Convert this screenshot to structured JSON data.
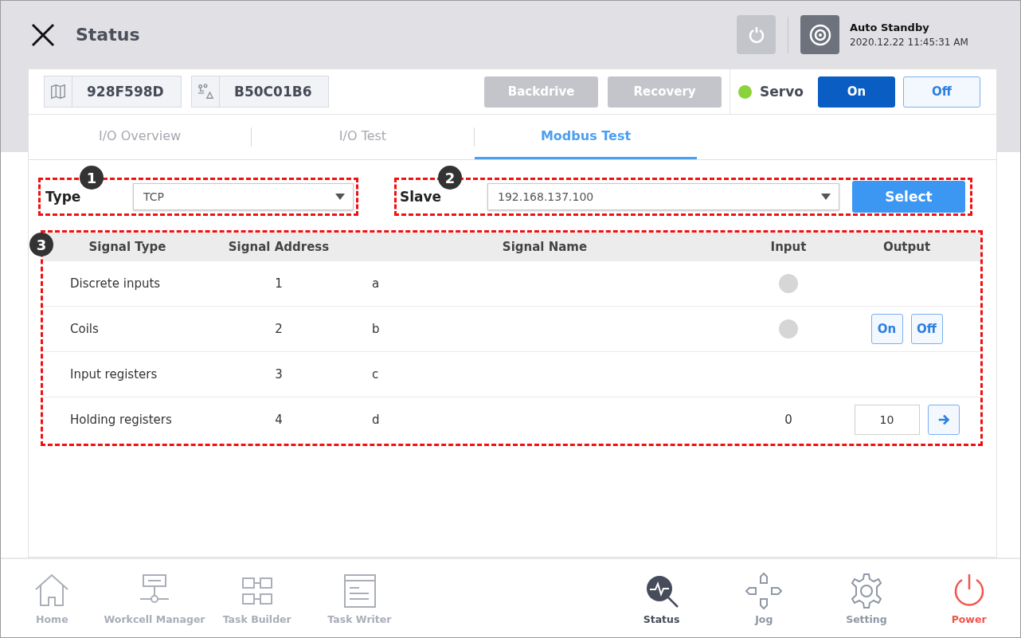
{
  "header": {
    "title": "Status",
    "mode": "Auto Standby",
    "datetime": "2020.12.22 11:45:31 AM"
  },
  "ids": [
    {
      "kind": "map",
      "text": "928F598D"
    },
    {
      "kind": "robot",
      "text": "B50C01B6"
    }
  ],
  "actions": [
    {
      "label": "Backdrive",
      "disabled": true
    },
    {
      "label": "Recovery",
      "disabled": true
    }
  ],
  "servo": {
    "label": "Servo",
    "on": true,
    "buttons": [
      {
        "label": "On",
        "selected": true
      },
      {
        "label": "Off",
        "selected": false
      }
    ]
  },
  "tabs": [
    {
      "label": "I/O Overview",
      "selected": false
    },
    {
      "label": "I/O Test",
      "selected": false
    },
    {
      "label": "Modbus Test",
      "selected": true
    }
  ],
  "type_field": {
    "callout": "1",
    "label": "Type",
    "value": "TCP"
  },
  "slave_field": {
    "callout": "2",
    "label": "Slave",
    "value": "192.168.137.100",
    "button": "Select"
  },
  "table": {
    "callout": "3",
    "columns": [
      "Signal Type",
      "Signal Address",
      "Signal Name",
      "Input",
      "Output"
    ],
    "rows": [
      {
        "signal_type": "Discrete inputs",
        "address": "1",
        "name": "a",
        "input": {
          "kind": "lamp",
          "on": false
        }
      },
      {
        "signal_type": "Coils",
        "address": "2",
        "name": "b",
        "input": {
          "kind": "lamp",
          "on": false
        },
        "output": {
          "kind": "toggle",
          "buttons": [
            "On",
            "Off"
          ]
        }
      },
      {
        "signal_type": "Input registers",
        "address": "3",
        "name": "c"
      },
      {
        "signal_type": "Holding registers",
        "address": "4",
        "name": "d",
        "input": {
          "kind": "value",
          "text": "0"
        },
        "output": {
          "kind": "entry",
          "value": "10"
        }
      }
    ]
  },
  "nav": [
    {
      "kind": "home",
      "label": "Home",
      "disabled": true,
      "selected": false
    },
    {
      "kind": "workcell",
      "label": "Workcell Manager",
      "disabled": true,
      "selected": false
    },
    {
      "kind": "builder",
      "label": "Task Builder",
      "disabled": true,
      "selected": false
    },
    {
      "kind": "writer",
      "label": "Task Writer",
      "disabled": true,
      "selected": false
    },
    {
      "kind": "status",
      "label": "Status",
      "disabled": false,
      "selected": true
    },
    {
      "kind": "jog",
      "label": "Jog",
      "disabled": false,
      "selected": false
    },
    {
      "kind": "setting",
      "label": "Setting",
      "disabled": false,
      "selected": false
    },
    {
      "kind": "power",
      "label": "Power",
      "disabled": false,
      "selected": false
    }
  ]
}
